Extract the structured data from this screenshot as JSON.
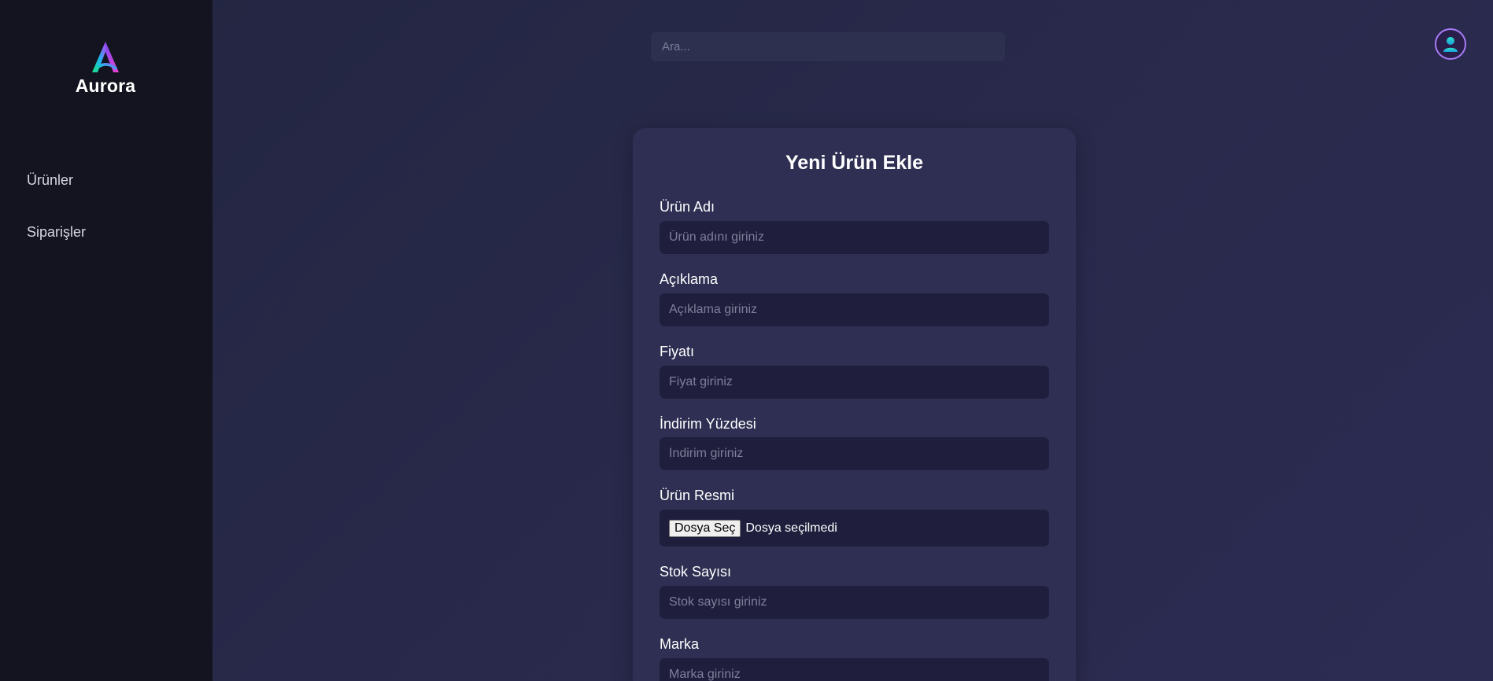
{
  "brand": {
    "name": "Aurora"
  },
  "sidebar": {
    "items": [
      {
        "label": "Ürünler"
      },
      {
        "label": "Siparişler"
      }
    ]
  },
  "header": {
    "search": {
      "placeholder": "Ara...",
      "value": ""
    },
    "avatar_icon": "user-icon"
  },
  "form": {
    "title": "Yeni Ürün Ekle",
    "fields": [
      {
        "label": "Ürün Adı",
        "placeholder": "Ürün adını giriniz",
        "value": ""
      },
      {
        "label": "Açıklama",
        "placeholder": "Açıklama giriniz",
        "value": ""
      },
      {
        "label": "Fiyatı",
        "placeholder": "Fiyat giriniz",
        "value": ""
      },
      {
        "label": "İndirim Yüzdesi",
        "placeholder": "İndirim giriniz",
        "value": ""
      },
      {
        "label": "Ürün Resmi",
        "button_label": "Dosya Seç",
        "status": "Dosya seçilmedi"
      },
      {
        "label": "Stok Sayısı",
        "placeholder": "Stok sayısı giriniz",
        "value": ""
      },
      {
        "label": "Marka",
        "placeholder": "Marka giriniz",
        "value": ""
      }
    ]
  },
  "colors": {
    "sidebar_bg": "#13141f",
    "main_bg": "#25264a",
    "card_bg": "#2e2f52",
    "input_bg": "#1f1f3d",
    "avatar_border": "#a87cf5"
  }
}
